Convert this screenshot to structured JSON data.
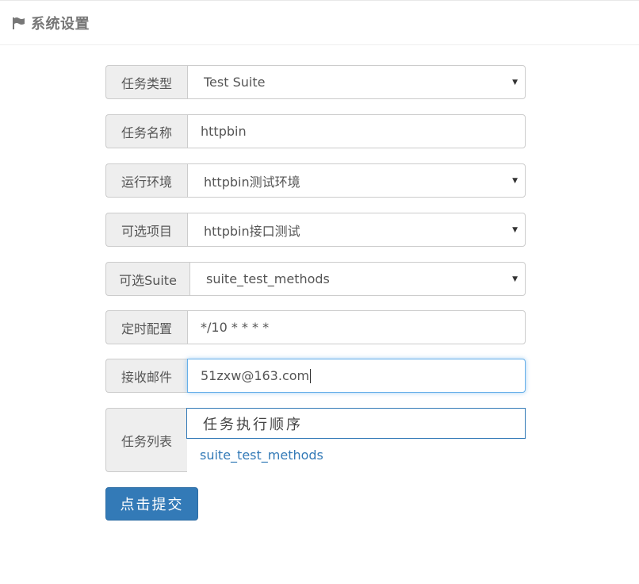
{
  "header": {
    "title": "系统设置",
    "icon": "flag-icon"
  },
  "form": {
    "task_type": {
      "label": "任务类型",
      "value": "Test Suite"
    },
    "task_name": {
      "label": "任务名称",
      "value": "httpbin"
    },
    "run_env": {
      "label": "运行环境",
      "value": "httpbin测试环境"
    },
    "project": {
      "label": "可选项目",
      "value": "httpbin接口测试"
    },
    "suite": {
      "label": "可选Suite",
      "value": "suite_test_methods"
    },
    "schedule": {
      "label": "定时配置",
      "value": "*/10 * * * *"
    },
    "email": {
      "label": "接收邮件",
      "value": "51zxw@163.com"
    },
    "task_list": {
      "label": "任务列表",
      "header": "任务执行顺序",
      "items": [
        "suite_test_methods"
      ]
    },
    "submit_label": "点击提交"
  },
  "colors": {
    "primary": "#337ab7",
    "addon_bg": "#eeeeee",
    "border": "#cccccc",
    "focus": "#66afe9"
  }
}
